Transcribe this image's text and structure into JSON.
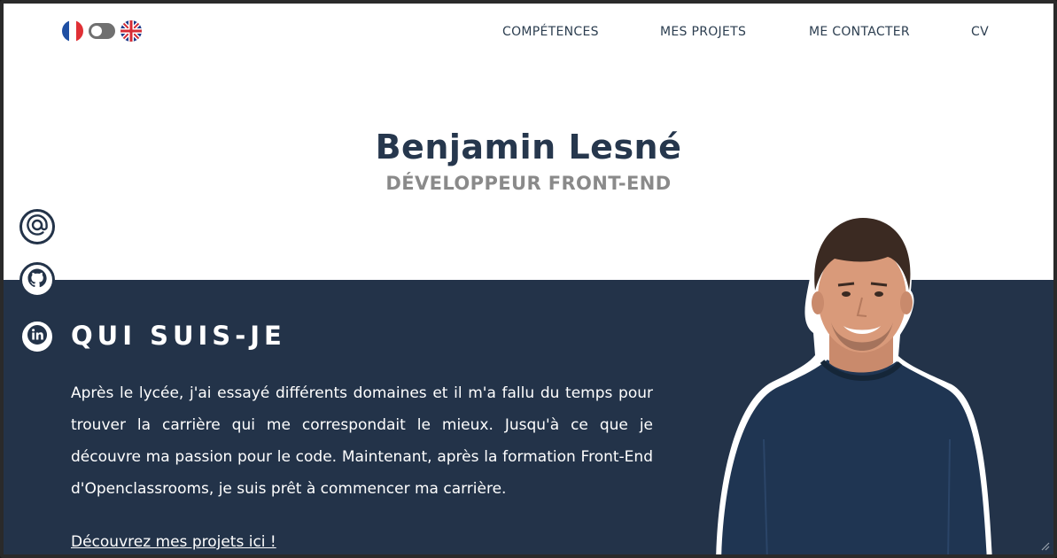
{
  "language_switch": {
    "left_flag": "french-flag-icon",
    "right_flag": "uk-flag-icon",
    "toggle_state": "off"
  },
  "nav": {
    "items": [
      {
        "label": "COMPÉTENCES"
      },
      {
        "label": "MES PROJETS"
      },
      {
        "label": "ME CONTACTER"
      },
      {
        "label": "CV"
      }
    ]
  },
  "hero": {
    "name": "Benjamin Lesné",
    "role": "DÉVELOPPEUR FRONT-END"
  },
  "social": {
    "items": [
      {
        "icon": "at-sign-icon"
      },
      {
        "icon": "github-icon"
      },
      {
        "icon": "linkedin-icon"
      }
    ]
  },
  "about": {
    "title": "QUI SUIS-JE",
    "text": "Après le lycée, j'ai essayé différents domaines et il m'a fallu du temps pour trouver la carrière qui me correspondait le mieux. Jusqu'à ce que je découvre ma passion pour le code. Maintenant, après la formation  Front-End d'Openclassrooms, je suis prêt à commencer ma carrière.",
    "link": "Découvrez mes projets ici !"
  },
  "colors": {
    "navy": "#233349",
    "title": "#26374d",
    "subtitle": "#8a8a8a",
    "background": "#ffffff"
  }
}
